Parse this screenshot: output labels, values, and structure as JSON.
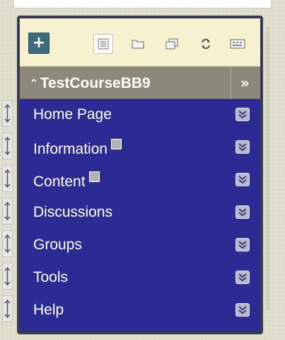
{
  "toolbar": {
    "add_icon": "plus-icon",
    "icons": [
      "list-view-icon",
      "folder-icon",
      "window-icon",
      "refresh-icon",
      "keyboard-icon"
    ]
  },
  "course": {
    "title": "TestCourseBB9",
    "collapse_icon": "double-chevron-up-icon",
    "expand_icon": "double-chevron-right-icon"
  },
  "menu": {
    "items": [
      {
        "label": "Home Page",
        "has_indicator": false
      },
      {
        "label": "Information",
        "has_indicator": true
      },
      {
        "label": "Content",
        "has_indicator": true
      },
      {
        "label": "Discussions",
        "has_indicator": false
      },
      {
        "label": "Groups",
        "has_indicator": false
      },
      {
        "label": "Tools",
        "has_indicator": false
      },
      {
        "label": "Help",
        "has_indicator": false
      }
    ]
  },
  "colors": {
    "menu_background": "#2b2b93",
    "header_background": "#8c887a",
    "toolbar_background": "#f6f2cf",
    "add_button": "#3f6b7e"
  }
}
